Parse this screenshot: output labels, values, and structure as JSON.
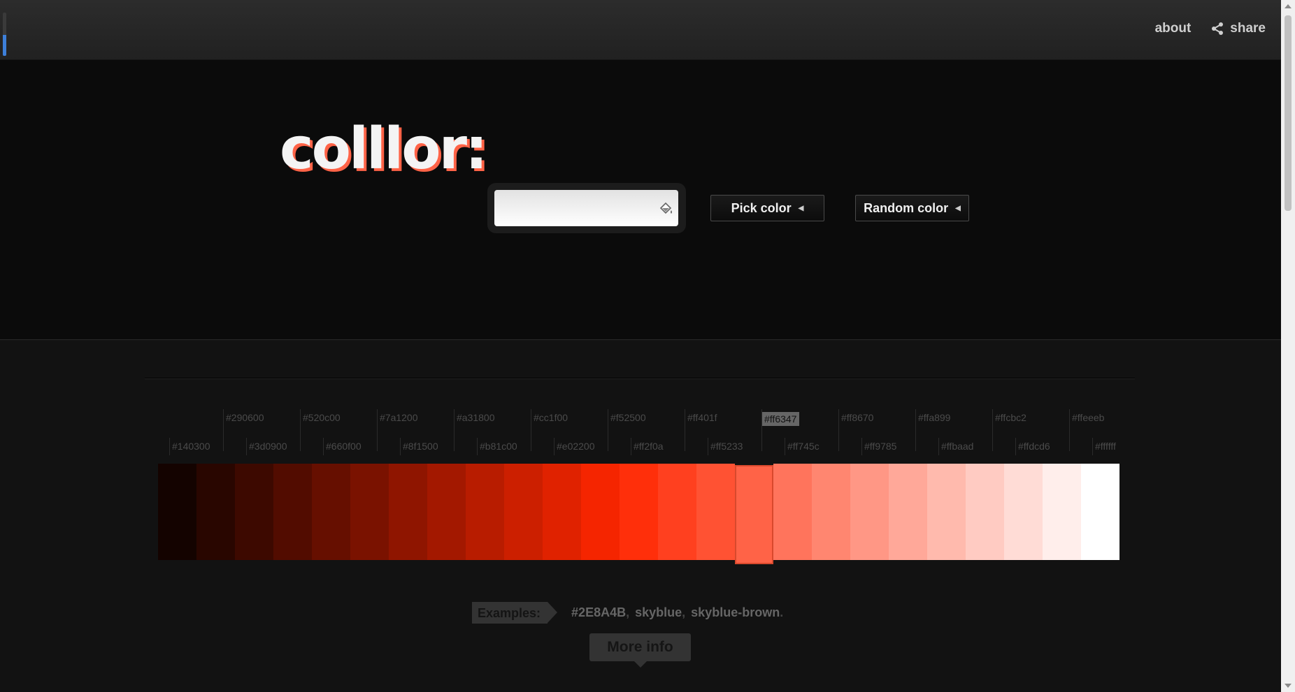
{
  "header": {
    "nav_about": "about",
    "nav_share": "share",
    "loader_fraction": 0.48
  },
  "hero": {
    "logo_text": "colllor:",
    "input_value": "",
    "pick_label": "Pick color",
    "random_label": "Random color"
  },
  "palette": {
    "selected_index": 15,
    "colors": [
      "#140300",
      "#290600",
      "#3d0900",
      "#520c00",
      "#660f00",
      "#7a1200",
      "#8f1500",
      "#a31800",
      "#b81c00",
      "#cc1f00",
      "#e02200",
      "#f52500",
      "#ff2f0a",
      "#ff401f",
      "#ff5233",
      "#ff6347",
      "#ff745c",
      "#ff8670",
      "#ff9785",
      "#ffa899",
      "#ffbaad",
      "#ffcbc2",
      "#ffdcd6",
      "#ffeeeb",
      "#ffffff"
    ],
    "labels": [
      "#140300",
      "#290600",
      "#3d0900",
      "#520c00",
      "#660f00",
      "#7a1200",
      "#8f1500",
      "#a31800",
      "#b81c00",
      "#cc1f00",
      "#e02200",
      "#f52500",
      "#ff2f0a",
      "#ff401f",
      "#ff5233",
      "#ff6347",
      "#ff745c",
      "#ff8670",
      "#ff9785",
      "#ffa899",
      "#ffbaad",
      "#ffcbc2",
      "#ffdcd6",
      "#ffeeeb",
      "#ffffff"
    ]
  },
  "examples": {
    "label": "Examples:",
    "items": [
      "#2E8A4B",
      "skyblue",
      "skyblue-brown"
    ],
    "separator": ",",
    "terminator": "."
  },
  "more_info_label": "More info",
  "colors": {
    "accent": "#ff6347",
    "background": "#0b0b0b",
    "progress": "#3d7fd9"
  }
}
